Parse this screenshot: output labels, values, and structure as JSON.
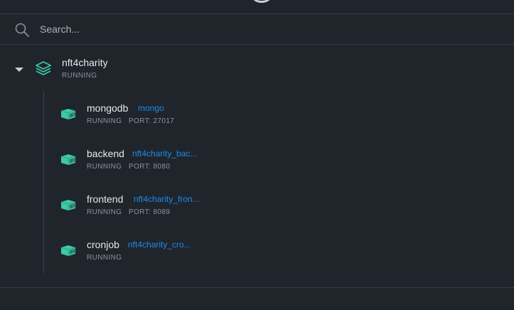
{
  "search": {
    "placeholder": "Search..."
  },
  "stack": {
    "name": "nft4charity",
    "status": "RUNNING",
    "containers": [
      {
        "name": "mongodb",
        "image": "mongo",
        "status": "RUNNING",
        "port": "PORT: 27017"
      },
      {
        "name": "backend",
        "image": "nft4charity_bac...",
        "status": "RUNNING",
        "port": "PORT: 8080"
      },
      {
        "name": "frontend",
        "image": "nft4charity_fron...",
        "status": "RUNNING",
        "port": "PORT: 8089"
      },
      {
        "name": "cronjob",
        "image": "nft4charity_cro...",
        "status": "RUNNING",
        "port": ""
      }
    ]
  },
  "icons": {
    "search": "search-icon",
    "stack": "stack-layers-icon",
    "container": "container-icon",
    "expand": "caret-down-icon"
  },
  "colors": {
    "background": "#1f252b",
    "accent_teal": "#3ec9a7",
    "link_blue": "#1f8bec",
    "text_primary": "#e6e9ec",
    "text_secondary": "#8a939c"
  }
}
